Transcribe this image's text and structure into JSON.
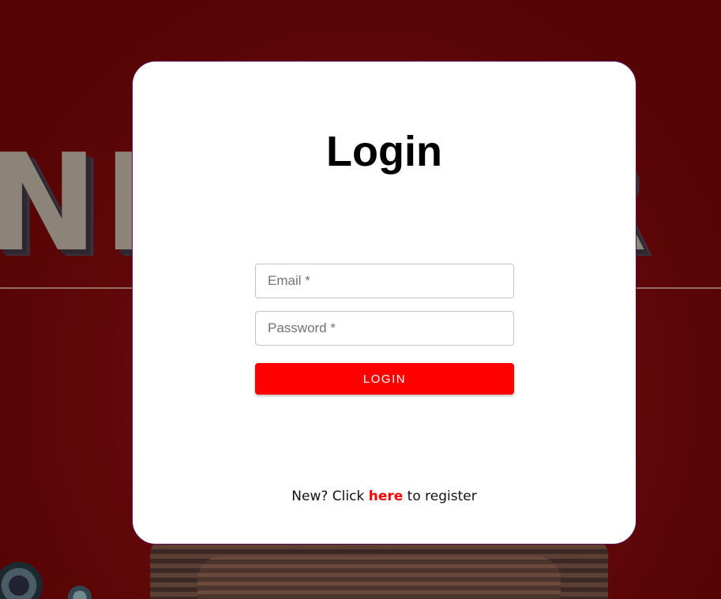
{
  "background": {
    "title_text": "NKILLER",
    "accent_color": "#5a0303"
  },
  "login_card": {
    "title": "Login",
    "email": {
      "placeholder": "Email *",
      "value": ""
    },
    "password": {
      "placeholder": "Password *",
      "value": ""
    },
    "login_button_label": "LOGIN",
    "register_prefix": "New? Click ",
    "register_link_label": "here",
    "register_suffix": " to register",
    "colors": {
      "button": "#ff0000",
      "link": "#ff0000",
      "card_border": "#5b0a55"
    }
  }
}
